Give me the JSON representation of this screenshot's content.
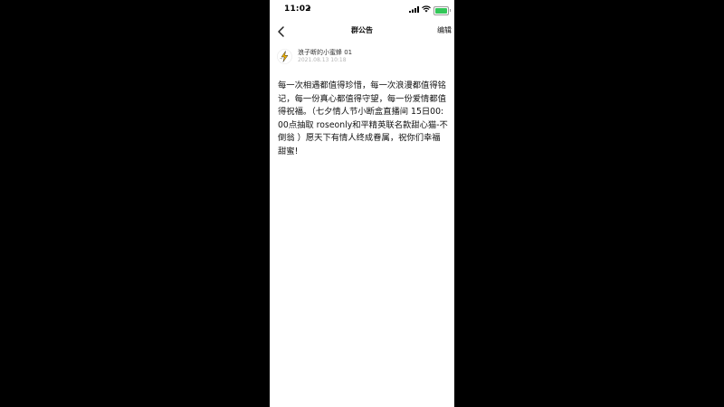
{
  "status_bar": {
    "time": "11:02",
    "icons": [
      "location-arrow-icon",
      "signal-icon",
      "wifi-icon",
      "battery-icon"
    ],
    "battery_color": "#34c759"
  },
  "nav": {
    "title": "群公告",
    "edit_label": "编辑",
    "back_icon": "chevron-left-icon"
  },
  "announcement": {
    "author_name": "浪子断的小蜜蜂 01",
    "timestamp": "2021.08.13 10:18",
    "content": "每一次相遇都值得珍惜，每一次浪漫都值得铭记，每一份真心都值得守望，每一份爱情都值得祝福。（七夕情人节小断盒直播间 15日00:00点抽取 roseonly和平精英联名款甜心猫-不倒翁 ）愿天下有情人终成眷属，祝你们幸福甜蜜!"
  },
  "colors": {
    "background": "#000000",
    "screen": "#ffffff",
    "timestamp": "#b5b5b5"
  }
}
